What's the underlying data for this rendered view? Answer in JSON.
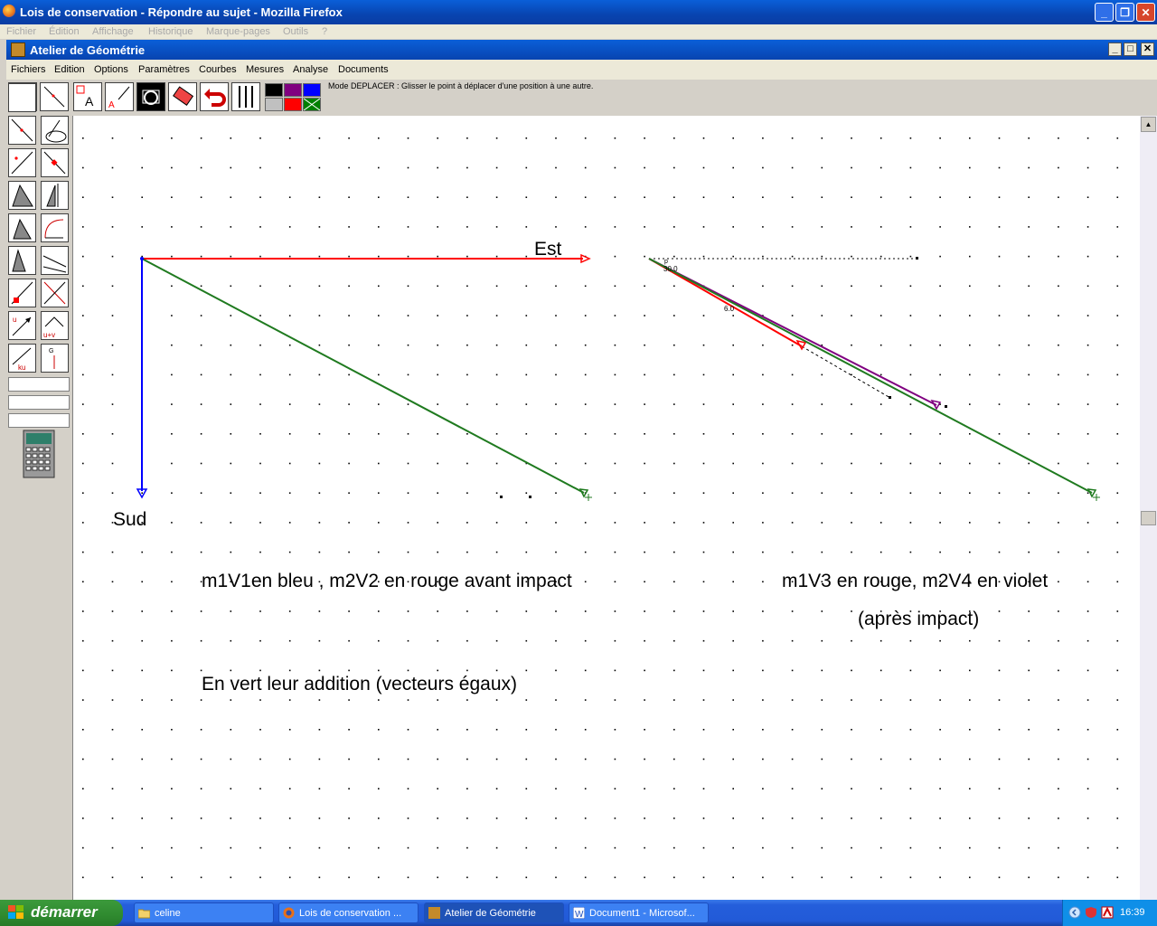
{
  "browser": {
    "title": "Lois de conservation - Répondre au sujet - Mozilla Firefox",
    "menu": [
      "Fichier",
      "Édition",
      "Affichage",
      "Historique",
      "Marque-pages",
      "Outils",
      "?"
    ]
  },
  "app": {
    "title": "Atelier de Géométrie",
    "menu": [
      "Fichiers",
      "Edition",
      "Options",
      "Paramètres",
      "Courbes",
      "Mesures",
      "Analyse",
      "Documents"
    ],
    "mode_text": "Mode DEPLACER : Glisser le point à déplacer d'une position à une autre."
  },
  "canvas": {
    "label_est": "Est",
    "label_sud": "Sud",
    "text_before": "m1V1en bleu , m2V2 en rouge avant impact",
    "text_after_1": "m1V3 en rouge,  m2V4  en violet",
    "text_after_2": "(après impact)",
    "text_sum": "En vert leur addition (vecteurs égaux)",
    "angle_label_1": "30.0",
    "angle_label_2": "6.0",
    "angle_label_small": "p",
    "colors": {
      "blue": "#0000ff",
      "red": "#ff0000",
      "green": "#1f7a1f",
      "violet": "#800080"
    }
  },
  "taskbar": {
    "start": "démarrer",
    "tasks": [
      "celine",
      "Lois de conservation ...",
      "Atelier de Géométrie",
      "Document1 - Microsof..."
    ],
    "clock": "16:39"
  }
}
